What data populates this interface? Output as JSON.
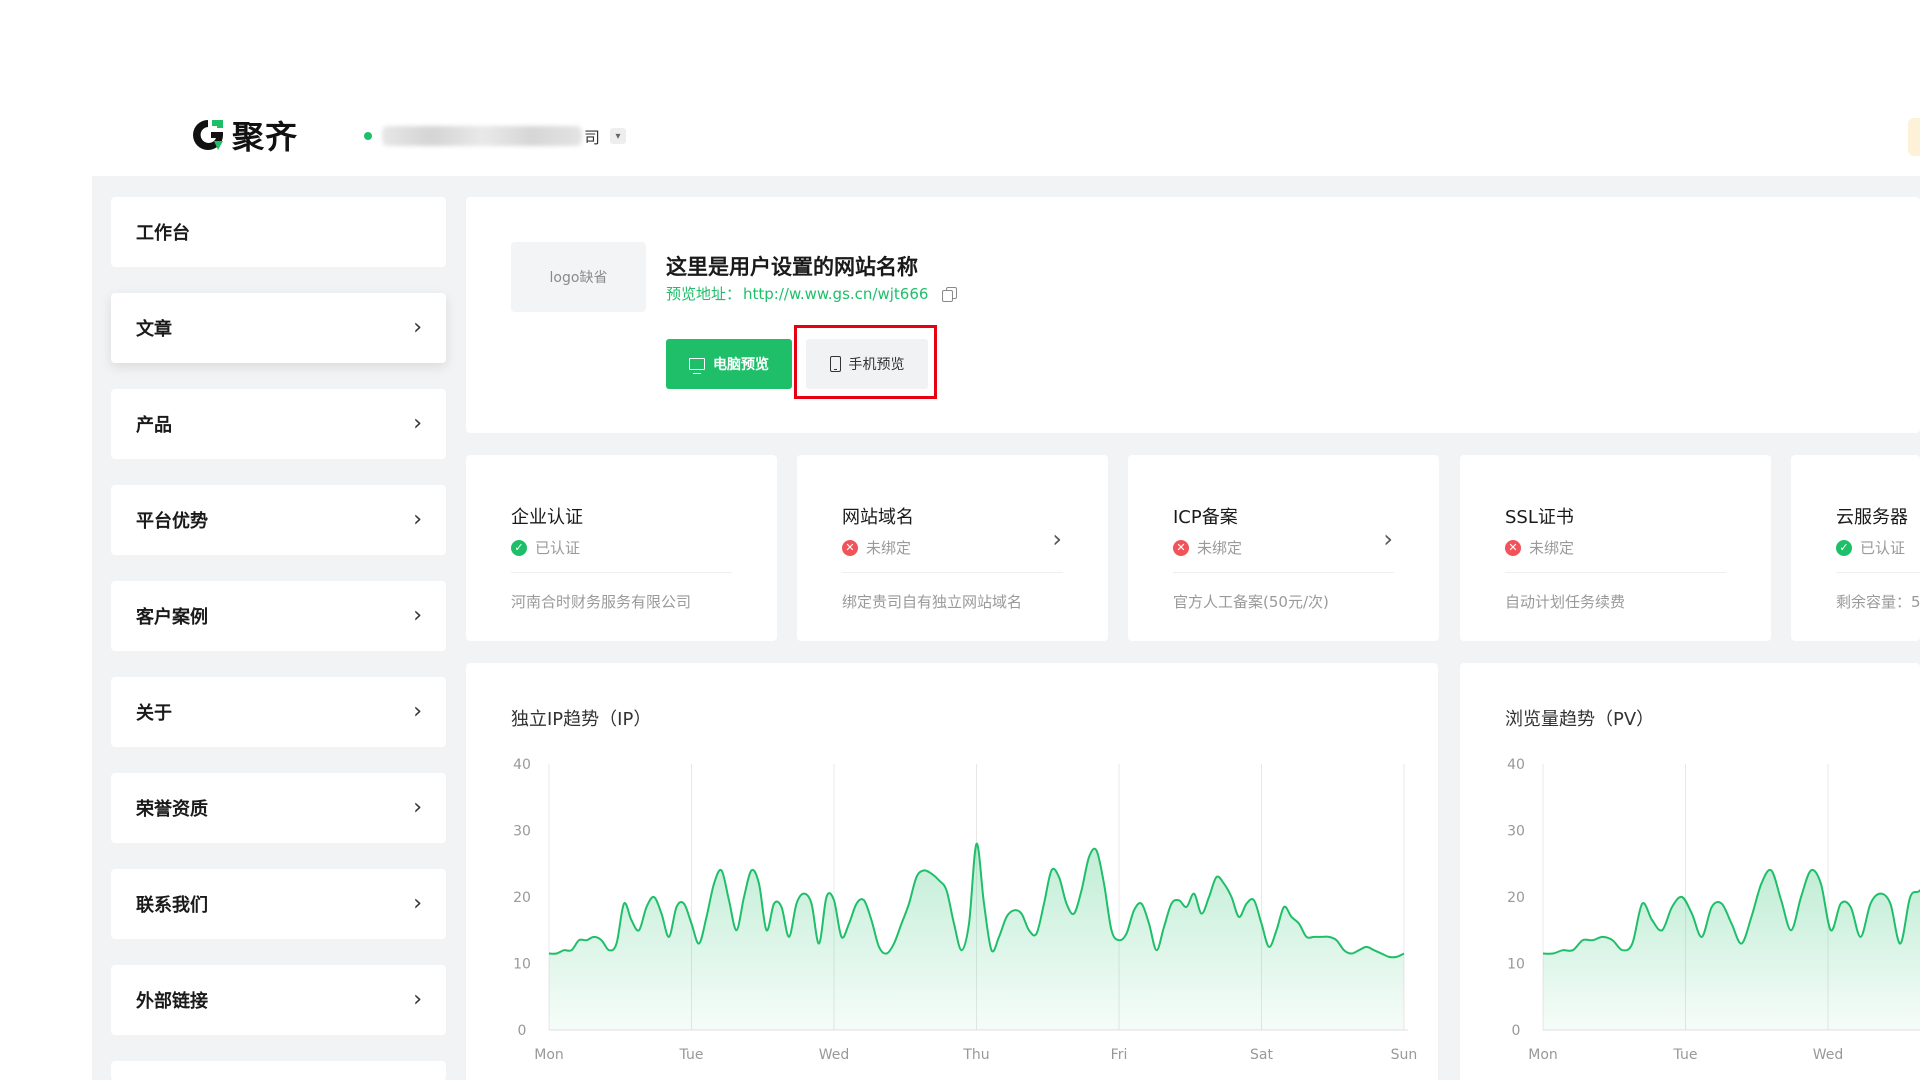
{
  "header": {
    "brand": "聚齐",
    "company_tail": "司",
    "caret": "▾"
  },
  "sidebar": {
    "items": [
      {
        "label": "工作台",
        "has_arrow": false
      },
      {
        "label": "文章",
        "has_arrow": true,
        "active": true
      },
      {
        "label": "产品",
        "has_arrow": true
      },
      {
        "label": "平台优势",
        "has_arrow": true
      },
      {
        "label": "客户案例",
        "has_arrow": true
      },
      {
        "label": "关于",
        "has_arrow": true
      },
      {
        "label": "荣誉资质",
        "has_arrow": true
      },
      {
        "label": "联系我们",
        "has_arrow": true
      },
      {
        "label": "外部链接",
        "has_arrow": true
      }
    ]
  },
  "site": {
    "logo_placeholder": "logo缺省",
    "name": "这里是用户设置的网站名称",
    "preview_label": "预览地址：",
    "preview_url": "http://w.ww.gs.cn/wjt666",
    "pc_preview": "电脑预览",
    "mobile_preview": "手机预览"
  },
  "status_cards": [
    {
      "title": "企业认证",
      "status": "已认证",
      "ok": true,
      "desc": "河南合时财务服务有限公司",
      "arrow": false
    },
    {
      "title": "网站域名",
      "status": "未绑定",
      "ok": false,
      "desc": "绑定贵司自有独立网站域名",
      "arrow": true
    },
    {
      "title": "ICP备案",
      "status": "未绑定",
      "ok": false,
      "desc": "官方人工备案(50元/次)",
      "arrow": true
    },
    {
      "title": "SSL证书",
      "status": "未绑定",
      "ok": false,
      "desc": "自动计划任务续费",
      "arrow": false
    },
    {
      "title": "云服务器",
      "status": "已认证",
      "ok": true,
      "desc": "剩余容量：5",
      "arrow": false
    }
  ],
  "colors": {
    "accent": "#1fbf6a",
    "error": "#f0545a",
    "highlight": "#e60012",
    "background": "#f2f3f5"
  },
  "chart_data": [
    {
      "type": "area",
      "title": "独立IP趋势（IP）",
      "categories": [
        "Mon",
        "Tue",
        "Wed",
        "Thu",
        "Fri",
        "Sat",
        "Sun"
      ],
      "yticks": [
        0,
        10,
        20,
        30,
        40
      ],
      "ylim": [
        0,
        40
      ],
      "grid": "vertical",
      "series": [
        {
          "values": [
            11.5,
            11.5,
            12,
            12,
            13.5,
            13.5,
            14,
            13.5,
            12,
            13,
            19,
            16.5,
            15,
            18.5,
            20,
            17.5,
            14,
            18.5,
            19,
            16,
            13,
            17,
            22,
            24,
            19.5,
            15,
            20,
            24,
            22,
            15,
            19,
            18.5,
            14,
            19,
            20.5,
            19,
            13,
            20,
            19.5,
            14,
            16,
            19,
            19.5,
            16.5,
            12.5,
            11.5,
            13,
            16,
            19,
            23,
            24,
            23.5,
            22.5,
            21,
            16,
            12,
            16,
            28,
            19,
            12,
            14,
            17,
            18,
            17.5,
            15,
            14.5,
            19,
            24,
            23,
            19,
            17.5,
            21,
            26,
            27,
            22,
            15,
            13.5,
            14.5,
            18,
            19,
            16,
            12,
            15.5,
            19,
            19.5,
            18.5,
            20.5,
            17.5,
            20,
            23,
            22,
            20,
            17,
            19,
            19.5,
            16,
            12.5,
            15,
            18.5,
            17,
            16,
            14,
            14,
            14,
            14,
            13.5,
            12,
            11.5,
            12,
            12.5,
            12,
            11.5,
            11,
            11,
            11.5
          ]
        }
      ]
    },
    {
      "type": "area",
      "title": "浏览量趋势（PV）",
      "categories": [
        "Mon",
        "Tue",
        "Wed"
      ],
      "yticks": [
        0,
        10,
        20,
        30,
        40
      ],
      "ylim": [
        0,
        40
      ],
      "grid": "vertical",
      "series": [
        {
          "values": [
            11.5,
            11.5,
            12,
            12,
            13.5,
            13.5,
            14,
            13.5,
            12,
            13,
            19,
            16.5,
            15,
            18.5,
            20,
            17.5,
            14,
            18.5,
            19,
            16,
            13,
            17,
            22,
            24,
            19.5,
            15,
            20,
            24,
            22,
            15,
            19,
            18.5,
            14,
            19,
            20.5,
            19,
            13,
            20,
            21,
            24,
            24
          ]
        }
      ]
    }
  ]
}
